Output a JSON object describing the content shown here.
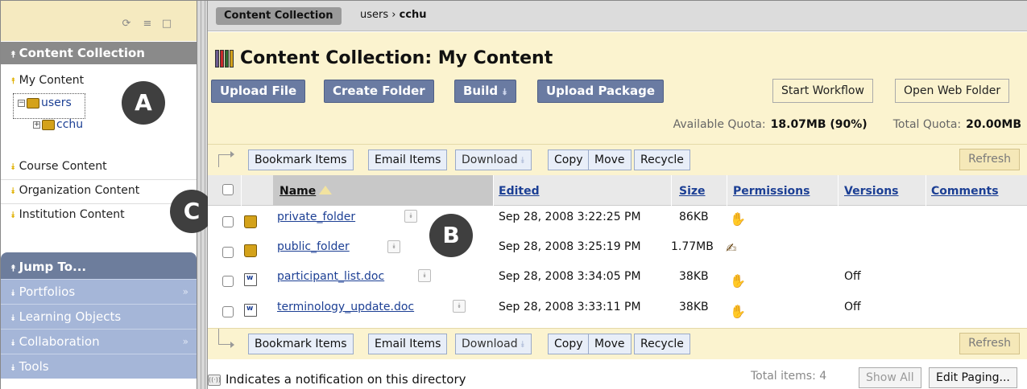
{
  "sidebar": {
    "toolbar_icons": [
      "refresh-icon",
      "list-icon",
      "folder-icon"
    ],
    "content_collection_header": "Content Collection",
    "my_content": "My Content",
    "tree": {
      "root": "users",
      "child": "cchu"
    },
    "links": [
      "Course Content",
      "Organization Content",
      "Institution Content"
    ],
    "jump_header": "Jump To...",
    "jump_items": [
      "Portfolios",
      "Learning Objects",
      "Collaboration",
      "Tools"
    ]
  },
  "callouts": {
    "a": "A",
    "b": "B",
    "c": "C"
  },
  "breadcrumb": {
    "tab": "Content Collection",
    "path_root": "users",
    "separator": "›",
    "path_leaf": "cchu"
  },
  "header": {
    "title": "Content Collection: My Content",
    "buttons": {
      "upload_file": "Upload File",
      "create_folder": "Create Folder",
      "build": "Build",
      "upload_package": "Upload Package"
    },
    "right_buttons": {
      "start_workflow": "Start Workflow",
      "open_web_folder": "Open Web Folder"
    },
    "quota": {
      "available_label": "Available Quota:",
      "available_value": "18.07MB (90%)",
      "total_label": "Total Quota:",
      "total_value": "20.00MB"
    }
  },
  "actions": {
    "bookmark": "Bookmark Items",
    "email": "Email Items",
    "download": "Download",
    "copy": "Copy",
    "move": "Move",
    "recycle": "Recycle",
    "refresh": "Refresh"
  },
  "table": {
    "columns": {
      "name": "Name",
      "edited": "Edited",
      "size": "Size",
      "permissions": "Permissions",
      "versions": "Versions",
      "comments": "Comments"
    },
    "rows": [
      {
        "name": "private_folder",
        "type": "folder",
        "edited": "Sep 28, 2008 3:22:25 PM",
        "size": "86KB",
        "permission_icon": "hand-icon",
        "versions": ""
      },
      {
        "name": "public_folder",
        "type": "folder",
        "edited": "Sep 28, 2008 3:25:19 PM",
        "size": "1.77MB",
        "permission_icon": "shared-hand-icon",
        "versions": ""
      },
      {
        "name": "participant_list.doc",
        "type": "doc",
        "edited": "Sep 28, 2008 3:34:05 PM",
        "size": "38KB",
        "permission_icon": "hand-icon",
        "versions": "Off"
      },
      {
        "name": "terminology_update.doc",
        "type": "doc",
        "edited": "Sep 28, 2008 3:33:11 PM",
        "size": "38KB",
        "permission_icon": "hand-icon",
        "versions": "Off"
      }
    ]
  },
  "footer": {
    "note": "Indicates a notification on this directory",
    "total_items": "Total items: 4",
    "show_all": "Show All",
    "edit_paging": "Edit Paging..."
  },
  "colors": {
    "header_bg": "#fbf3cf",
    "button_blue": "#6a7ba2",
    "jump_bg": "#a5b6d8",
    "link": "#1c3f94"
  }
}
